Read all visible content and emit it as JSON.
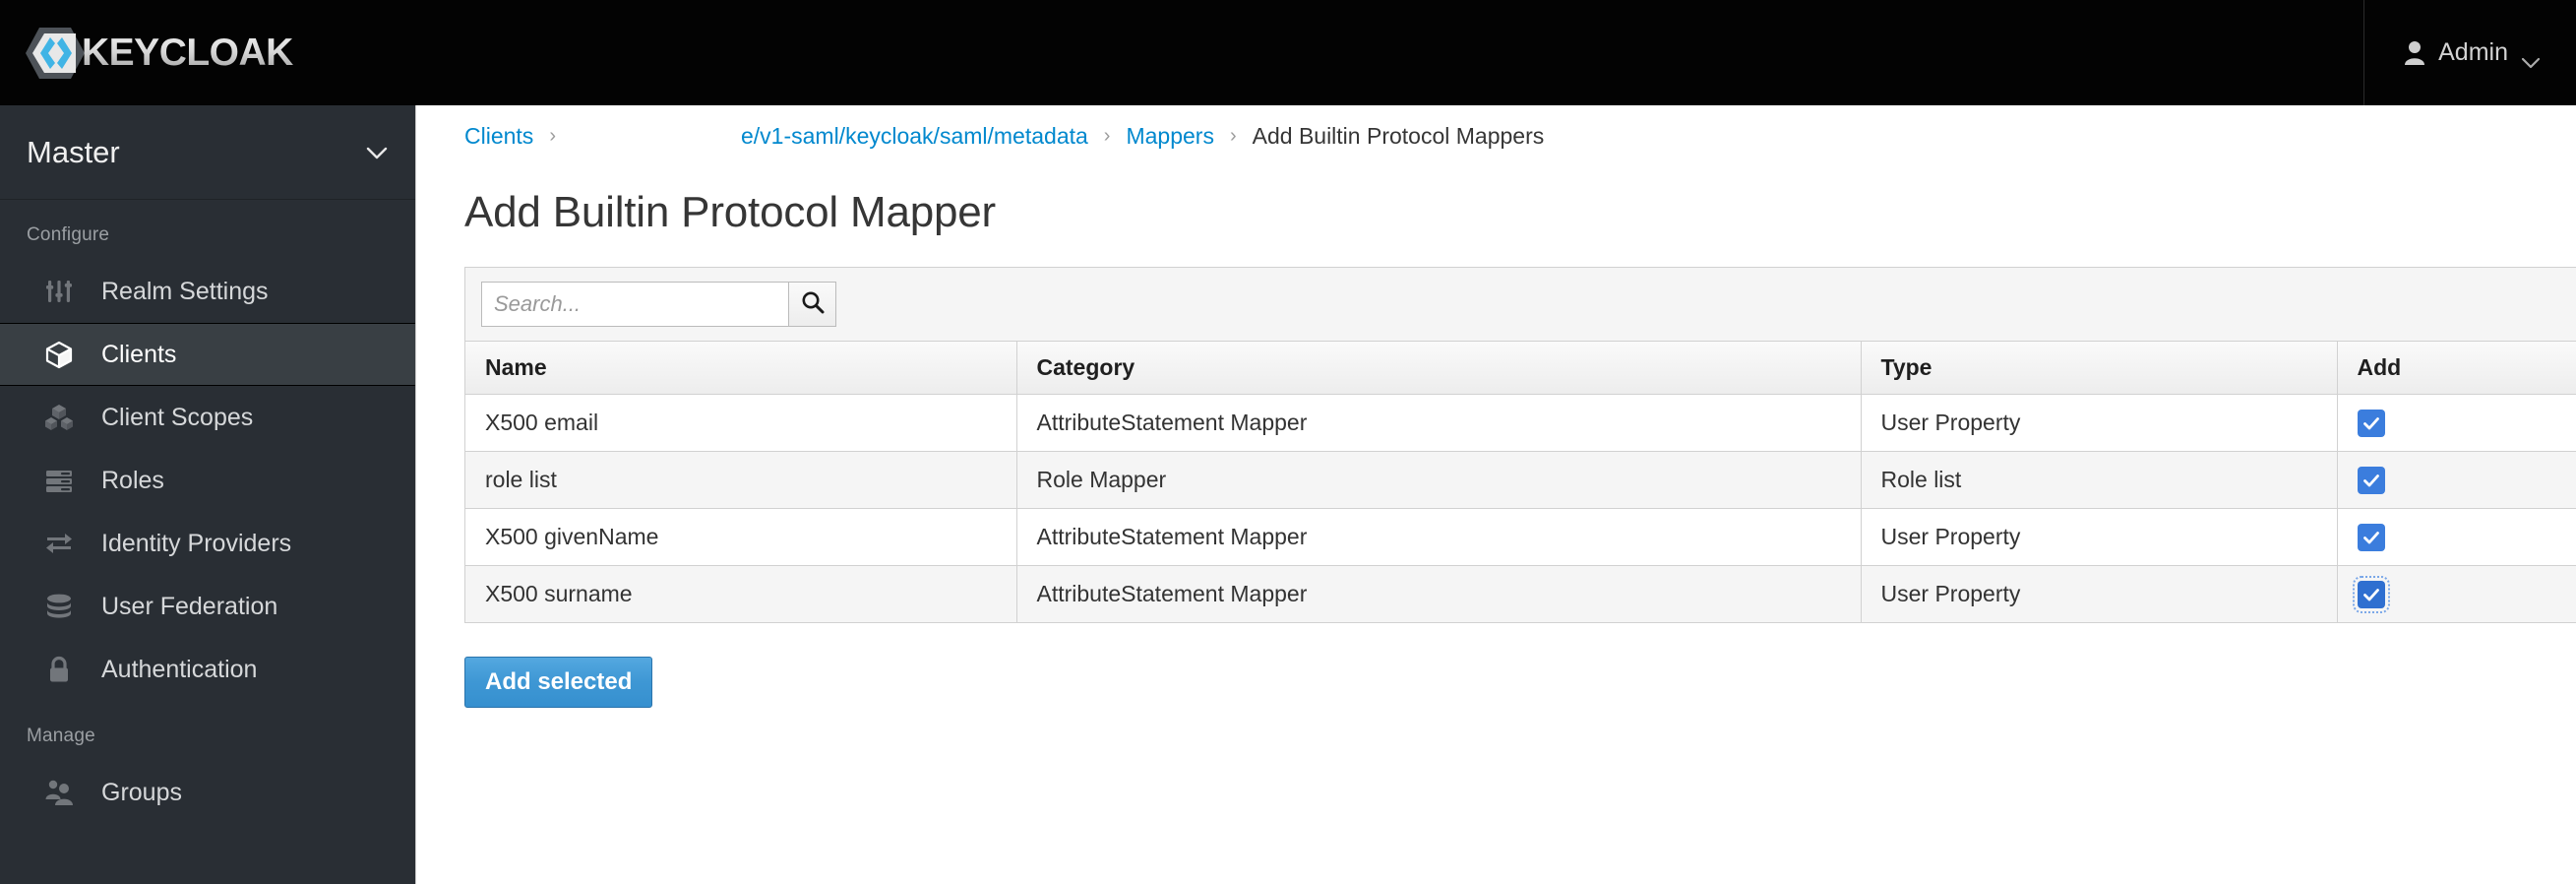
{
  "masthead": {
    "brand_text": "KEYCLOAK",
    "user_label": "Admin"
  },
  "sidebar": {
    "realm": {
      "name": "Master"
    },
    "sections": [
      {
        "label": "Configure",
        "items": [
          {
            "label": "Realm Settings",
            "icon": "sliders-icon",
            "active": false
          },
          {
            "label": "Clients",
            "icon": "cube-icon",
            "active": true
          },
          {
            "label": "Client Scopes",
            "icon": "cubes-icon",
            "active": false
          },
          {
            "label": "Roles",
            "icon": "list-icon",
            "active": false
          },
          {
            "label": "Identity Providers",
            "icon": "exchange-arrows-icon",
            "active": false
          },
          {
            "label": "User Federation",
            "icon": "database-icon",
            "active": false
          },
          {
            "label": "Authentication",
            "icon": "lock-icon",
            "active": false
          }
        ]
      },
      {
        "label": "Manage",
        "items": [
          {
            "label": "Groups",
            "icon": "users-icon",
            "active": false
          }
        ]
      }
    ]
  },
  "breadcrumb": {
    "item1": "Clients",
    "item2": "e/v1-saml/keycloak/saml/metadata",
    "item3": "Mappers",
    "item4": "Add Builtin Protocol Mappers",
    "separator": "›"
  },
  "page": {
    "title": "Add Builtin Protocol Mapper"
  },
  "search": {
    "placeholder": "Search...",
    "value": "",
    "icon": "search-icon"
  },
  "table": {
    "headers": {
      "name": "Name",
      "category": "Category",
      "type": "Type",
      "add": "Add"
    },
    "rows": [
      {
        "name": "X500 email",
        "category": "AttributeStatement Mapper",
        "type": "User Property",
        "checked": true,
        "focused": false
      },
      {
        "name": "role list",
        "category": "Role Mapper",
        "type": "Role list",
        "checked": true,
        "focused": false
      },
      {
        "name": "X500 givenName",
        "category": "AttributeStatement Mapper",
        "type": "User Property",
        "checked": true,
        "focused": false
      },
      {
        "name": "X500 surname",
        "category": "AttributeStatement Mapper",
        "type": "User Property",
        "checked": true,
        "focused": true
      }
    ]
  },
  "actions": {
    "add_selected": "Add selected"
  },
  "colors": {
    "accent_blue": "#0088ce",
    "checkbox_blue": "#3b7ddd",
    "button_blue": "#3e97d4",
    "sidebar_bg": "#292e34",
    "sidebar_active_bg": "#393f44",
    "masthead_bg": "#030303",
    "logo_blue": "#40b4e5"
  }
}
